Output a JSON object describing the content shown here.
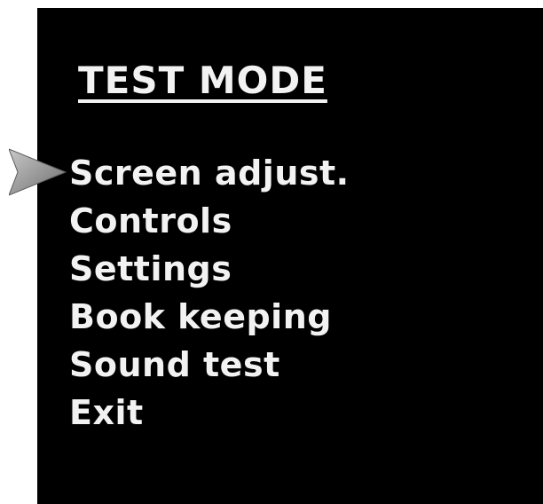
{
  "screen": {
    "title": "TEST MODE",
    "selected_index": 0,
    "menu": [
      {
        "label": "Screen adjust."
      },
      {
        "label": "Controls"
      },
      {
        "label": "Settings"
      },
      {
        "label": "Book keeping"
      },
      {
        "label": "Sound test"
      },
      {
        "label": "Exit"
      }
    ]
  },
  "colors": {
    "background": "#000000",
    "text": "#f2f2f2",
    "cursor": "#9a9a9a"
  },
  "icons": {
    "cursor": "selection-arrow-icon"
  }
}
